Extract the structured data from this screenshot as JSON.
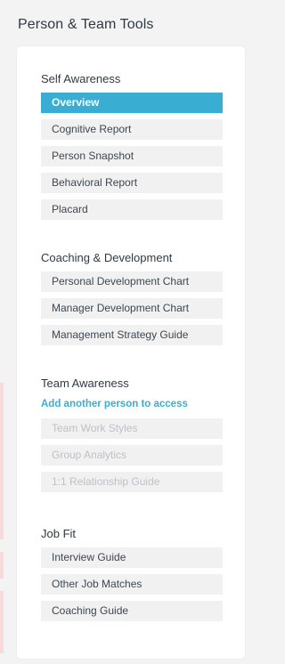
{
  "panel": {
    "title": "Person & Team Tools"
  },
  "sections": {
    "self_awareness": {
      "heading": "Self Awareness",
      "items": [
        "Overview",
        "Cognitive Report",
        "Person Snapshot",
        "Behavioral Report",
        "Placard"
      ],
      "active": "Overview"
    },
    "coaching": {
      "heading": "Coaching & Development",
      "items": [
        "Personal Development Chart",
        "Manager Development Chart",
        "Management Strategy Guide"
      ]
    },
    "team_awareness": {
      "heading": "Team Awareness",
      "link": "Add another person to access",
      "items": [
        "Team Work Styles",
        "Group Analytics",
        "1:1 Relationship Guide"
      ]
    },
    "job_fit": {
      "heading": "Job Fit",
      "items": [
        "Interview Guide",
        "Other Job Matches",
        "Coaching Guide"
      ]
    }
  },
  "colors": {
    "accent": "#3aaed2",
    "item_bg": "#f1f1f2",
    "disabled_text": "#bcc1c5",
    "heading_text": "#2f3a45"
  }
}
